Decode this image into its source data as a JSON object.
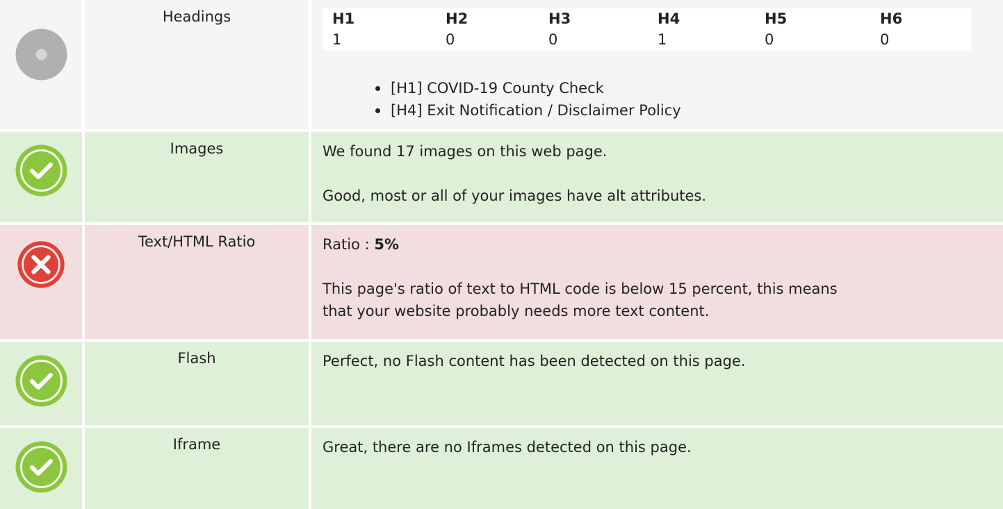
{
  "headings": {
    "label": "Headings",
    "status": "neutral",
    "table": [
      {
        "tag": "H1",
        "count": "1"
      },
      {
        "tag": "H2",
        "count": "0"
      },
      {
        "tag": "H3",
        "count": "0"
      },
      {
        "tag": "H4",
        "count": "1"
      },
      {
        "tag": "H5",
        "count": "0"
      },
      {
        "tag": "H6",
        "count": "0"
      }
    ],
    "list": [
      "[H1] COVID-19 County Check",
      "[H4] Exit Notification / Disclaimer Policy"
    ]
  },
  "images": {
    "label": "Images",
    "status": "pass",
    "line1": "We found 17 images on this web page.",
    "line2": "Good, most or all of your images have alt attributes."
  },
  "text_html_ratio": {
    "label": "Text/HTML Ratio",
    "status": "fail",
    "ratio_prefix": "Ratio : ",
    "ratio_value": "5%",
    "line1": "This page's ratio of text to HTML code is below 15 percent, this means",
    "line2": "that your website probably needs more text content."
  },
  "flash": {
    "label": "Flash",
    "status": "pass",
    "text": "Perfect, no Flash content has been detected on this page."
  },
  "iframe": {
    "label": "Iframe",
    "status": "pass",
    "text": "Great, there are no Iframes detected on this page."
  },
  "colors": {
    "pass_bg": "#dff0d8",
    "fail_bg": "#f2dede",
    "neutral_bg": "#f5f5f5",
    "pass_icon": "#8cc63f",
    "fail_icon": "#e0413a",
    "neutral_icon": "#b0b0b0"
  }
}
